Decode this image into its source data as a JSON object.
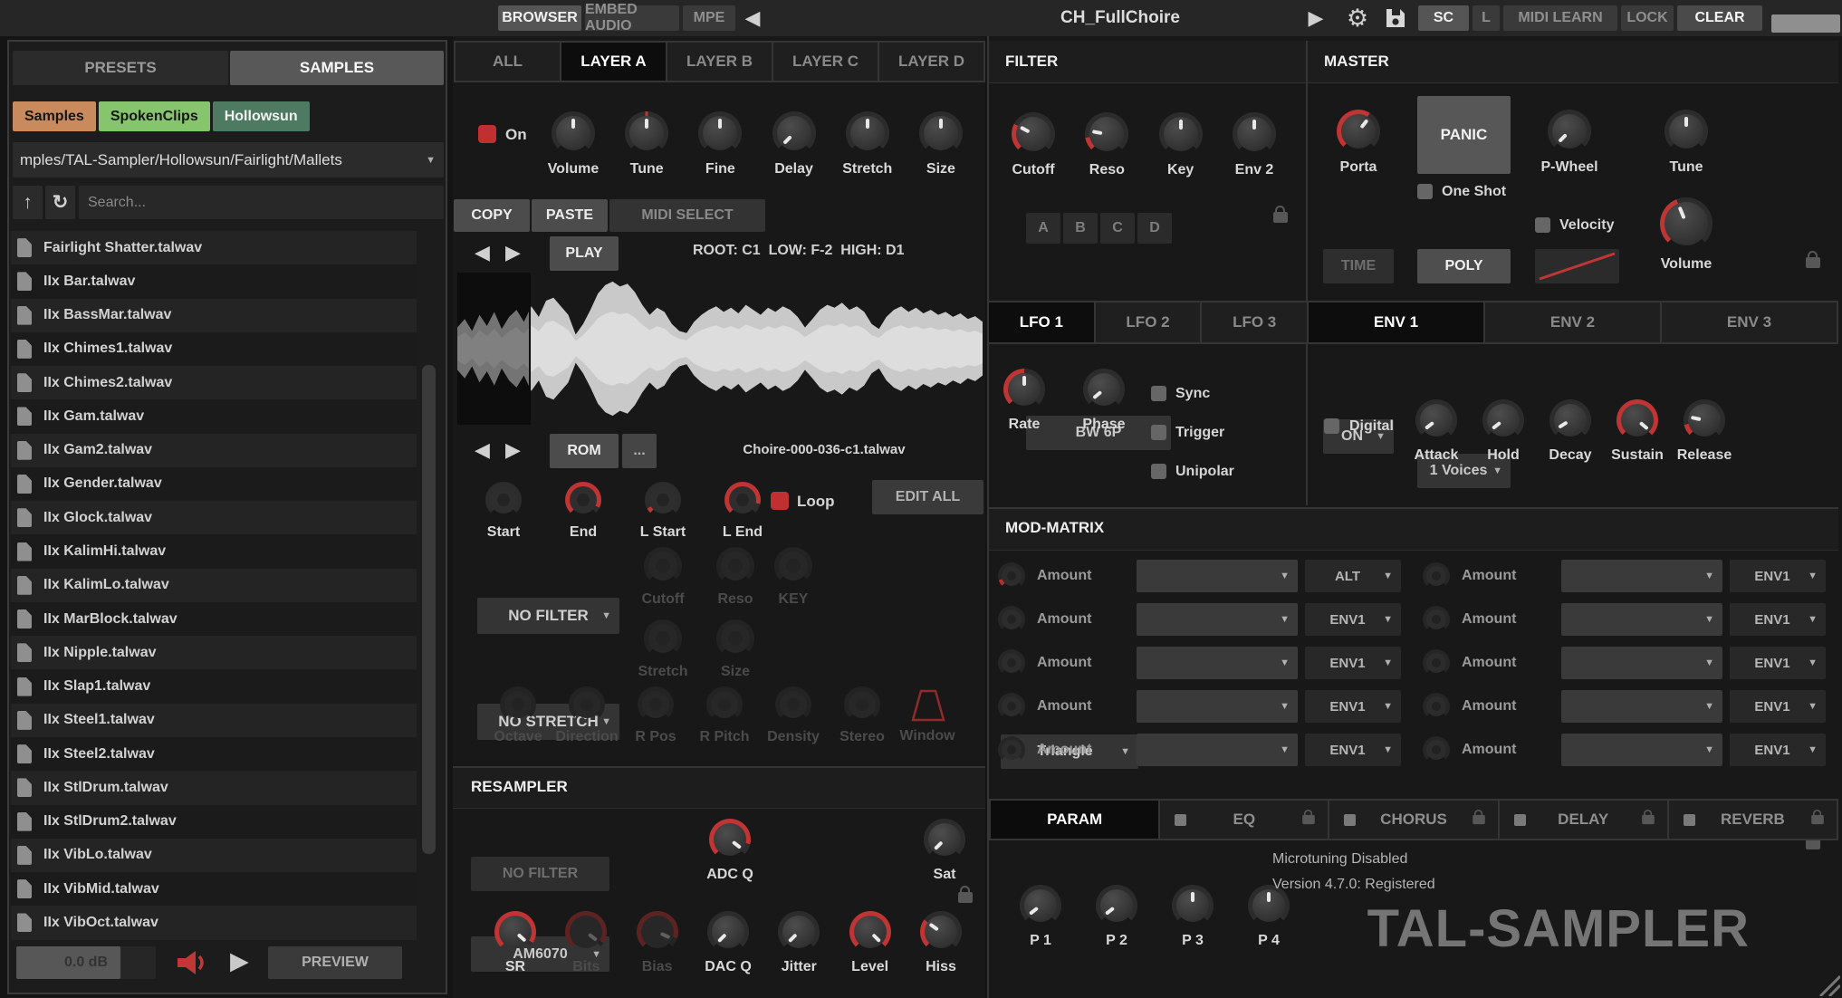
{
  "topbar": {
    "browser": "BROWSER",
    "embed_audio": "EMBED AUDIO",
    "mpe": "MPE",
    "title": "CH_FullChoire",
    "sc": "SC",
    "l": "L",
    "midi_learn": "MIDI LEARN",
    "lock": "LOCK",
    "clear": "CLEAR"
  },
  "sidebar": {
    "presets_tab": "PRESETS",
    "samples_tab": "SAMPLES",
    "tags": [
      {
        "label": "Samples",
        "bg": "#c98a5e",
        "fg": "#161616"
      },
      {
        "label": "SpokenClips",
        "bg": "#86c46d",
        "fg": "#161616"
      },
      {
        "label": "Hollowsun",
        "bg": "#4e7a62",
        "fg": "#f2f2f2"
      }
    ],
    "path": "mples/TAL-Sampler/Hollowsun/Fairlight/Mallets",
    "search_placeholder": "Search...",
    "files": [
      "Fairlight Shatter.talwav",
      "IIx Bar.talwav",
      "IIx BassMar.talwav",
      "IIx Chimes1.talwav",
      "IIx Chimes2.talwav",
      "IIx Gam.talwav",
      "IIx Gam2.talwav",
      "IIx Gender.talwav",
      "IIx Glock.talwav",
      "IIx KalimHi.talwav",
      "IIx KalimLo.talwav",
      "IIx MarBlock.talwav",
      "IIx Nipple.talwav",
      "IIx Slap1.talwav",
      "IIx Steel1.talwav",
      "IIx Steel2.talwav",
      "IIx StlDrum.talwav",
      "IIx StlDrum2.talwav",
      "IIx VibLo.talwav",
      "IIx VibMid.talwav",
      "IIx VibOct.talwav"
    ],
    "volume_db": "0.0 dB",
    "preview": "PREVIEW"
  },
  "layer": {
    "tabs": [
      {
        "label": "ALL"
      },
      {
        "label": "LAYER A",
        "sel": true
      },
      {
        "label": "LAYER B"
      },
      {
        "label": "LAYER C"
      },
      {
        "label": "LAYER D"
      }
    ],
    "on": "On",
    "top_knobs": [
      {
        "label": "Volume",
        "a": 0
      },
      {
        "label": "Tune",
        "a": 0,
        "mark": true
      },
      {
        "label": "Fine",
        "a": 0
      },
      {
        "label": "Delay",
        "a": -135
      },
      {
        "label": "Stretch",
        "a": 0
      },
      {
        "label": "Size",
        "a": 0
      }
    ],
    "copy": "COPY",
    "paste": "PASTE",
    "midi_select": "MIDI SELECT",
    "play": "PLAY",
    "root_info": "ROOT: C1  LOW: F-2  HIGH: D1",
    "rom": "ROM",
    "dots": "...",
    "sample_name": "Choire-000-036-c1.talwav",
    "sample_knobs": [
      {
        "label": "Start",
        "v": 0,
        "noptr": true
      },
      {
        "label": "End",
        "v": 0.93,
        "noptr": true
      },
      {
        "label": "L Start",
        "v": 0.06,
        "noptr": true
      },
      {
        "label": "L End",
        "v": 0.88,
        "noptr": true
      }
    ],
    "loop": "Loop",
    "edit_all": "EDIT ALL",
    "filter_dd": "NO FILTER",
    "filter_knobs": [
      {
        "label": "Cutoff",
        "dim": true
      },
      {
        "label": "Reso",
        "dim": true
      }
    ],
    "key_knob": [
      {
        "label": "KEY",
        "dim": true
      }
    ],
    "stretch_dd": "NO STRETCH",
    "stretch_knobs": [
      {
        "label": "Stretch",
        "dim": true
      },
      {
        "label": "Size",
        "dim": true
      }
    ],
    "granular_knobs": [
      {
        "label": "Octave",
        "dim": true
      },
      {
        "label": "Direction",
        "dim": true
      },
      {
        "label": "R Pos",
        "dim": true
      },
      {
        "label": "R Pitch",
        "dim": true
      },
      {
        "label": "Density",
        "dim": true
      },
      {
        "label": "Stereo",
        "dim": true
      }
    ],
    "window_label": "Window"
  },
  "resampler": {
    "title": "RESAMPLER",
    "model_dd": "AM6070",
    "filter_btn": "NO FILTER",
    "adc_knob": [
      {
        "label": "ADC Q",
        "v": 0.88,
        "a": 128
      }
    ],
    "sat_knob": [
      {
        "label": "Sat",
        "a": -135
      }
    ],
    "row_knobs": [
      {
        "label": "SR",
        "v": 0.95,
        "a": 132
      },
      {
        "label": "Bits",
        "v": 0.95,
        "a": 128,
        "dim": true
      },
      {
        "label": "Bias",
        "v": 0.9,
        "a": 115,
        "dim": true
      },
      {
        "label": "DAC Q",
        "a": -135
      },
      {
        "label": "Jitter",
        "a": -135
      },
      {
        "label": "Level",
        "v": 1,
        "a": 135
      },
      {
        "label": "Hiss",
        "v": 0.3,
        "a": -55
      }
    ]
  },
  "filter": {
    "title": "FILTER",
    "knobs": [
      {
        "label": "Cutoff",
        "v": 0.27,
        "a": -62
      },
      {
        "label": "Reso",
        "v": 0.13,
        "a": -80
      },
      {
        "label": "Key",
        "a": 0
      },
      {
        "label": "Env 2",
        "a": 0
      }
    ],
    "buttons": [
      {
        "label": "A",
        "sel": true
      },
      {
        "label": "B"
      },
      {
        "label": "C"
      },
      {
        "label": "D"
      }
    ],
    "type_dd": "BW 6P"
  },
  "master": {
    "title": "MASTER",
    "porta": [
      {
        "label": "Porta",
        "v": 0.62,
        "a": 38
      }
    ],
    "panic": "PANIC",
    "one_shot": "One Shot",
    "pwheel": [
      {
        "label": "P-Wheel",
        "a": -135
      }
    ],
    "tune": [
      {
        "label": "Tune",
        "a": 0
      }
    ],
    "on_dd": "ON",
    "time": "TIME",
    "voices_dd": "1 Voices",
    "poly": "POLY",
    "velocity": "Velocity",
    "volume": [
      {
        "label": "Volume",
        "v": 0.42,
        "a": -22
      }
    ]
  },
  "lfo": {
    "tabs": [
      {
        "label": "LFO 1",
        "sel": true
      },
      {
        "label": "LFO 2"
      },
      {
        "label": "LFO 3"
      }
    ],
    "knobs": [
      {
        "label": "Rate",
        "v": 0.5,
        "a": 0
      },
      {
        "label": "Phase",
        "a": -130
      }
    ],
    "sync": "Sync",
    "trigger": "Trigger",
    "unipolar": "Unipolar",
    "shape_dd": "Triangle"
  },
  "env": {
    "tabs": [
      {
        "label": "ENV 1",
        "sel": true
      },
      {
        "label": "ENV 2"
      },
      {
        "label": "ENV 3"
      }
    ],
    "digital": "Digital",
    "knobs": [
      {
        "label": "Attack",
        "a": -128
      },
      {
        "label": "Hold",
        "a": -128
      },
      {
        "label": "Decay",
        "a": -122
      },
      {
        "label": "Sustain",
        "v": 1,
        "a": 130
      },
      {
        "label": "Release",
        "v": 0.12,
        "a": -78
      }
    ]
  },
  "mod_matrix": {
    "title": "MOD-MATRIX",
    "first_knob_v": 0.1,
    "rows": [
      {
        "amount": "Amount",
        "src": "ALT"
      },
      {
        "amount": "Amount",
        "src": "ENV1"
      },
      {
        "amount": "Amount",
        "src": "ENV1"
      },
      {
        "amount": "Amount",
        "src": "ENV1"
      },
      {
        "amount": "Amount",
        "src": "ENV1"
      },
      {
        "amount": "Amount",
        "src": "ENV1"
      },
      {
        "amount": "Amount",
        "src": "ENV1"
      },
      {
        "amount": "Amount",
        "src": "ENV1"
      },
      {
        "amount": "Amount",
        "src": "ENV1"
      },
      {
        "amount": "Amount",
        "src": "ENV1"
      }
    ]
  },
  "fx_tabs": [
    {
      "label": "PARAM",
      "sel": true
    },
    {
      "label": "EQ"
    },
    {
      "label": "CHORUS"
    },
    {
      "label": "DELAY"
    },
    {
      "label": "REVERB"
    }
  ],
  "footer": {
    "microtuning": "Microtuning Disabled",
    "version": "Version 4.7.0: Registered",
    "logo": "TAL-SAMPLER",
    "p_knobs": [
      {
        "label": "P 1",
        "a": -128
      },
      {
        "label": "P 2",
        "a": -128
      },
      {
        "label": "P 3",
        "a": 0
      },
      {
        "label": "P 4",
        "a": 0
      }
    ]
  },
  "waveform": {
    "marker_frac": 0.138,
    "amplitudes": [
      0.3,
      0.42,
      0.25,
      0.48,
      0.32,
      0.52,
      0.28,
      0.45,
      0.55,
      0.38,
      0.6,
      0.45,
      0.68,
      0.72,
      0.6,
      0.48,
      0.2,
      0.35,
      0.55,
      0.78,
      0.9,
      0.95,
      0.88,
      0.92,
      0.8,
      0.62,
      0.48,
      0.58,
      0.52,
      0.35,
      0.25,
      0.22,
      0.38,
      0.48,
      0.55,
      0.6,
      0.52,
      0.58,
      0.5,
      0.62,
      0.55,
      0.48,
      0.58,
      0.52,
      0.6,
      0.55,
      0.45,
      0.3,
      0.42,
      0.55,
      0.62,
      0.58,
      0.65,
      0.55,
      0.6,
      0.52,
      0.35,
      0.28,
      0.45,
      0.55,
      0.6,
      0.52,
      0.58,
      0.5,
      0.55,
      0.48,
      0.52,
      0.45,
      0.5,
      0.42,
      0.46,
      0.38
    ]
  },
  "colors": {
    "accent_red": "#c13434",
    "dim_red": "#5d2323",
    "knob_track": "#2c2c2c",
    "knob_track_dim": "#232323"
  }
}
